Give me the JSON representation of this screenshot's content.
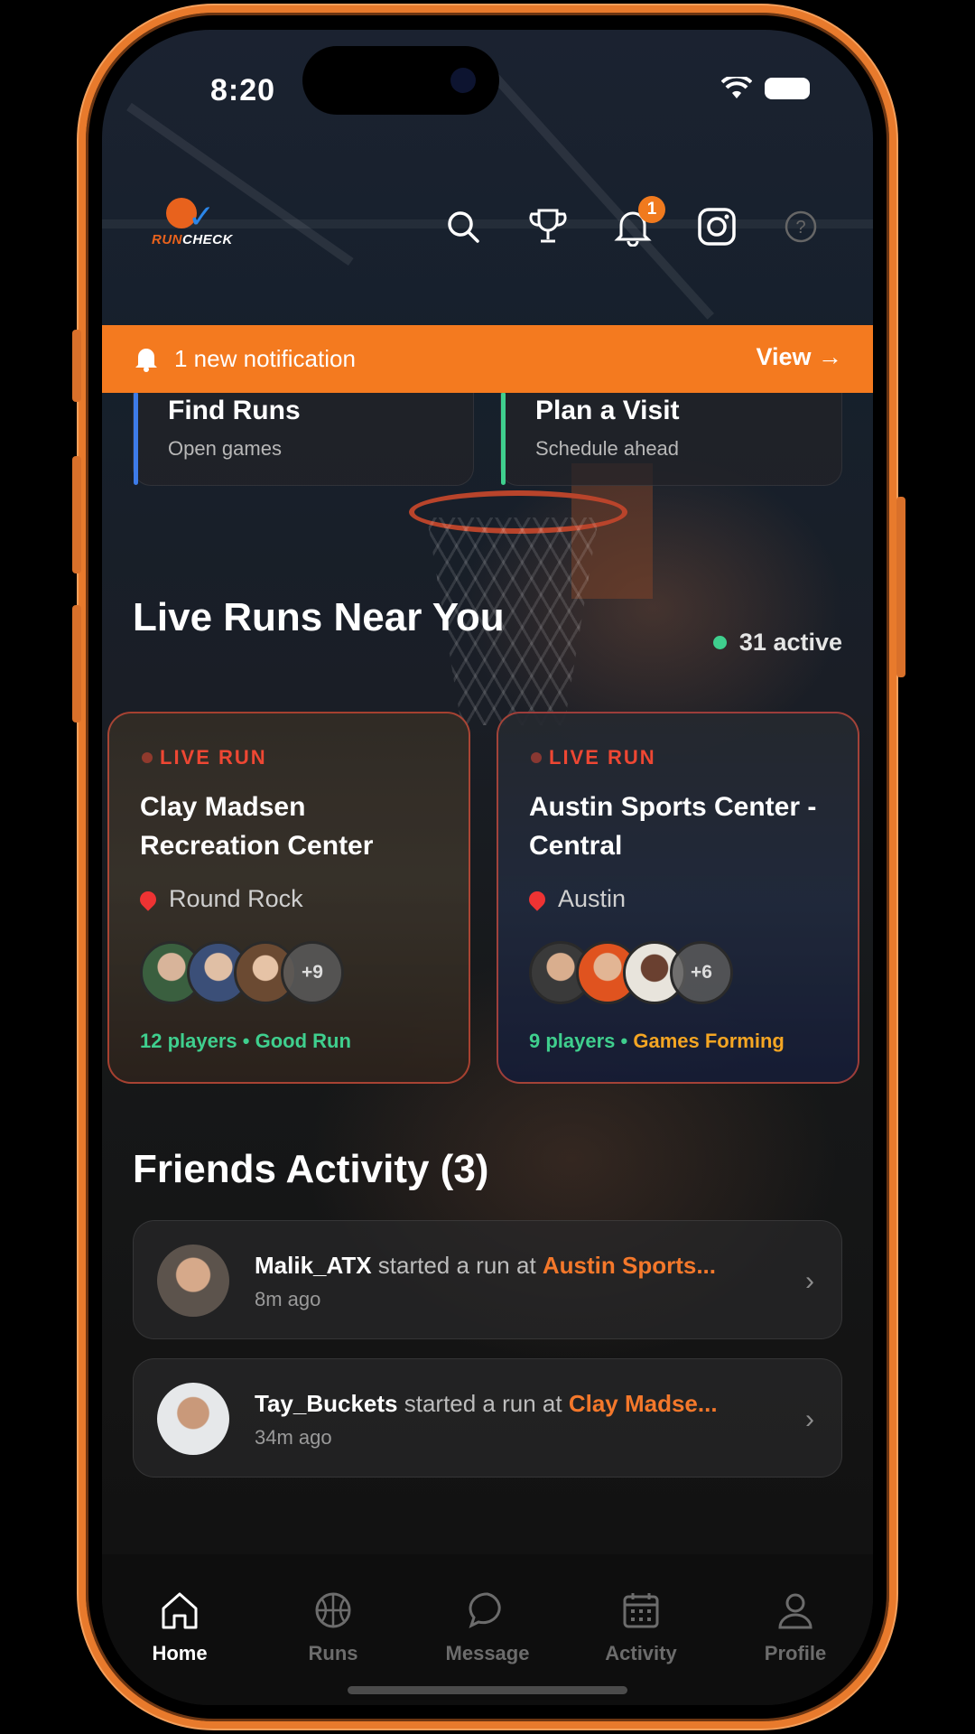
{
  "status_bar": {
    "time": "8:20"
  },
  "brand": {
    "logo_text_run": "RUN",
    "logo_text_check": "CHECK"
  },
  "header_icons": [
    {
      "icon": "search-icon"
    },
    {
      "icon": "trophy-icon"
    },
    {
      "icon": "bell-icon",
      "badge": "1"
    },
    {
      "icon": "instagram-icon"
    },
    {
      "icon": "help-icon"
    }
  ],
  "notification": {
    "text": "1 new notification",
    "action": "View →"
  },
  "quick_actions": [
    {
      "title": "Find Runs",
      "subtitle": "Open games",
      "accent": "#3d7be8"
    },
    {
      "title": "Plan a Visit",
      "subtitle": "Schedule ahead",
      "accent": "#3fcf8e"
    }
  ],
  "live_runs": {
    "title": "Live Runs Near You",
    "active_count": "31 active",
    "cards": [
      {
        "tag": "LIVE RUN",
        "name": "Clay Madsen Recreation Center",
        "location": "Round Rock",
        "more": "+9",
        "players": "12 players",
        "separator": "•",
        "status": "Good Run"
      },
      {
        "tag": "LIVE RUN",
        "name": "Austin Sports Center - Central",
        "location": "Austin",
        "more": "+6",
        "players": "9 players",
        "separator": "•",
        "status": "Games Forming"
      }
    ]
  },
  "friends": {
    "title": "Friends Activity (3)",
    "items": [
      {
        "user": "Malik_ATX",
        "action": " started a run at ",
        "place": "Austin Sports...",
        "time": "8m ago"
      },
      {
        "user": "Tay_Buckets",
        "action": " started a run at ",
        "place": "Clay Madse...",
        "time": "34m ago"
      }
    ]
  },
  "tabbar": {
    "items": [
      {
        "label": "Home",
        "icon": "home-icon",
        "active": true
      },
      {
        "label": "Runs",
        "icon": "basketball-icon"
      },
      {
        "label": "Message",
        "icon": "chat-bubble-icon"
      },
      {
        "label": "Activity",
        "icon": "calendar-icon"
      },
      {
        "label": "Profile",
        "icon": "person-icon"
      }
    ]
  },
  "colors": {
    "accent": "#f47a1f",
    "live_red": "#ee4733",
    "good_green": "#3fcf8e",
    "forming_orange": "#f5a623"
  }
}
